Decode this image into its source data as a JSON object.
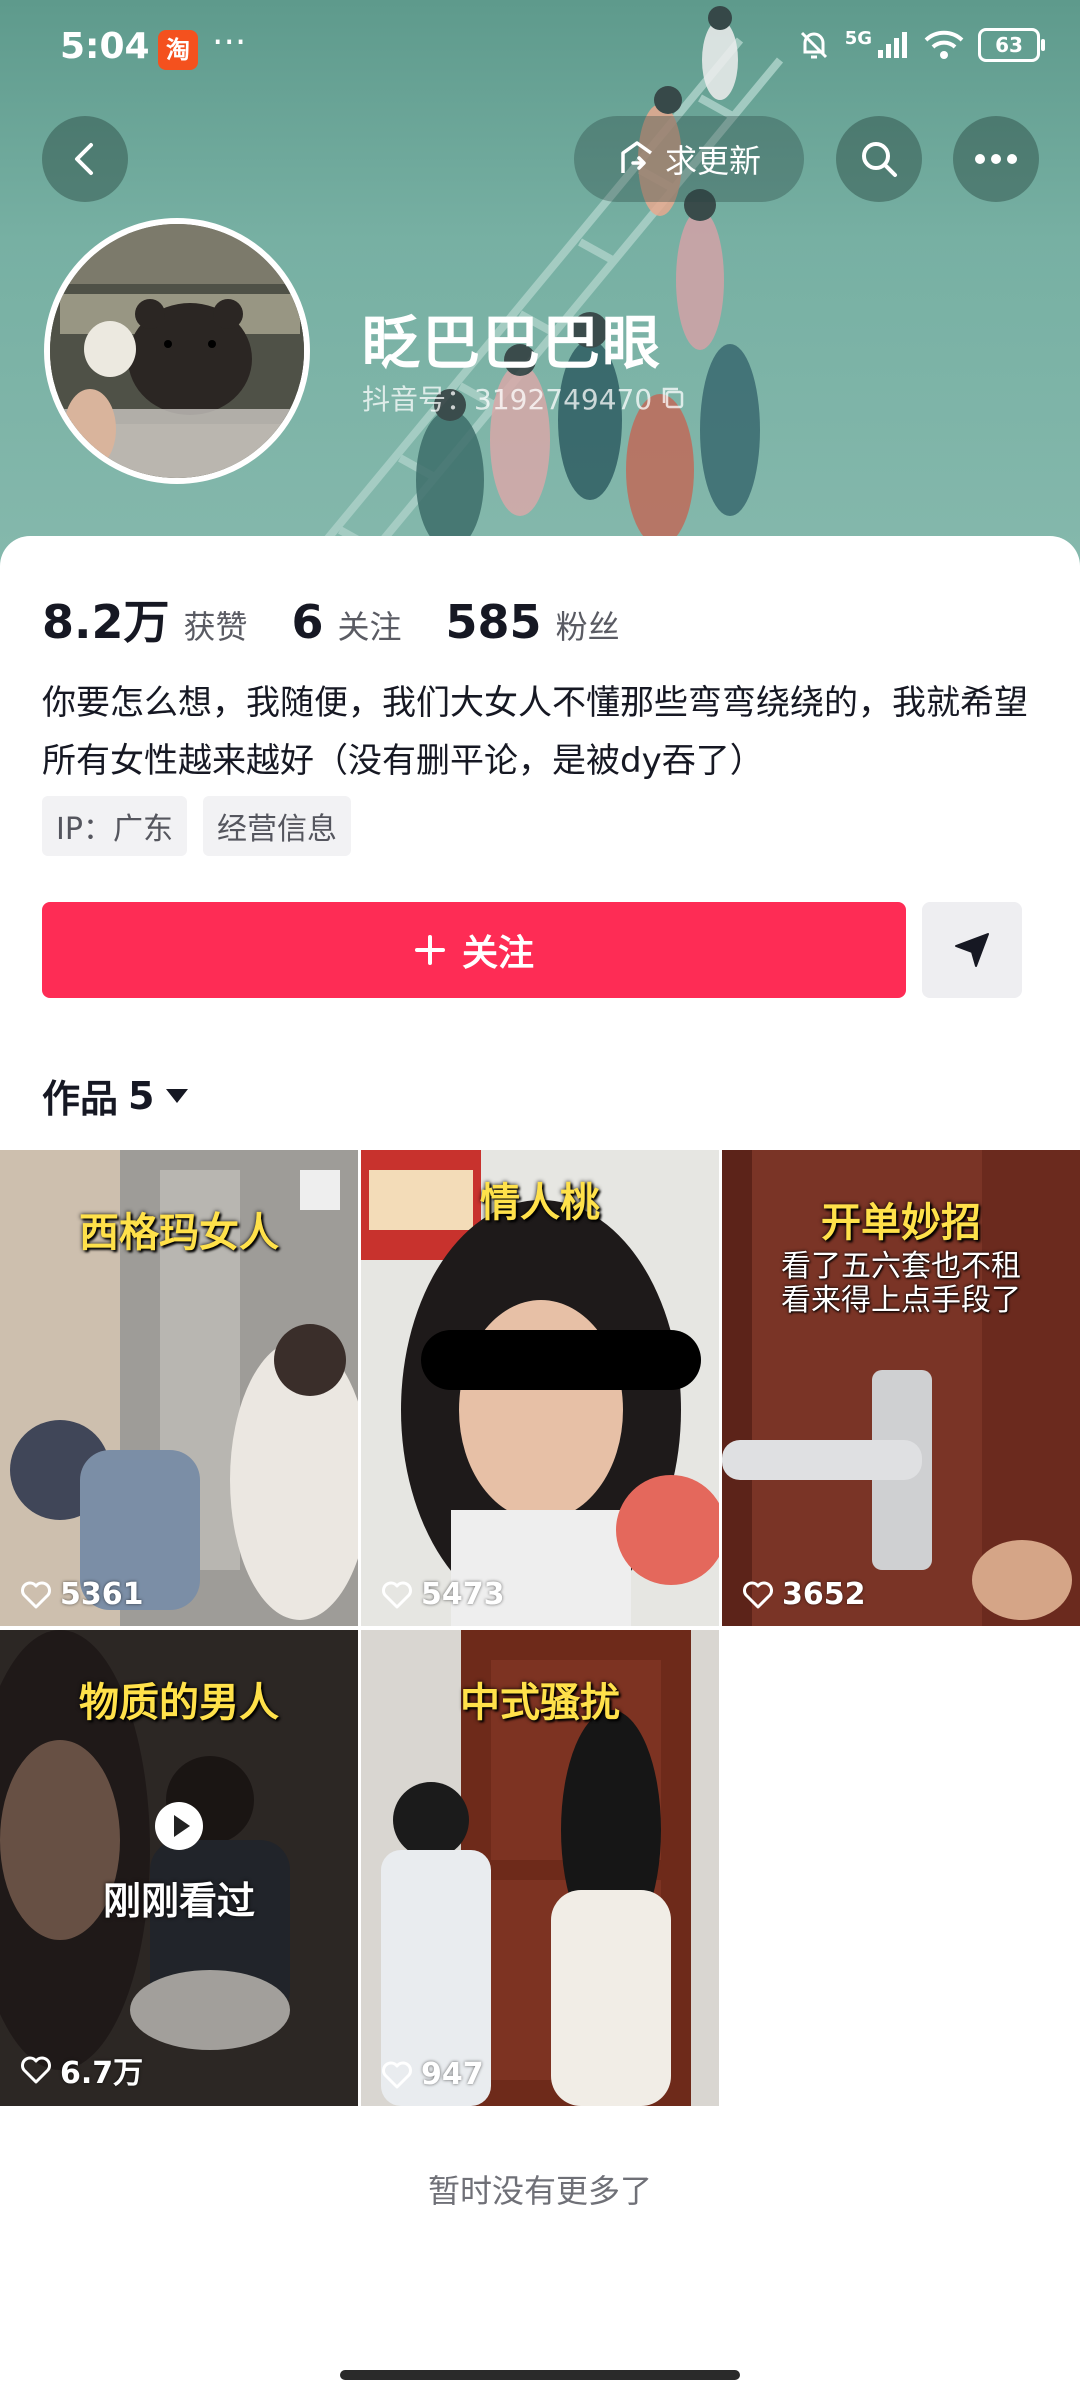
{
  "status_bar": {
    "time": "5:04",
    "app_badge": "淘",
    "more": "···",
    "signal": "5G",
    "battery": "63"
  },
  "header": {
    "update_label": "求更新"
  },
  "profile": {
    "name": "眨巴巴巴眼",
    "id_label": "抖音号：3192749470"
  },
  "stats": [
    {
      "value": "8.2万",
      "label": "获赞"
    },
    {
      "value": "6",
      "label": "关注"
    },
    {
      "value": "585",
      "label": "粉丝"
    }
  ],
  "bio": "你要怎么想，我随便，我们大女人不懂那些弯弯绕绕的，我就希望所有女性越来越好（没有删平论，是被dy吞了）",
  "tags": [
    "IP：广东",
    "经营信息"
  ],
  "follow_label": "关注",
  "works": {
    "title": "作品",
    "count": "5",
    "items": [
      {
        "title": "西格玛女人",
        "likes": "5361"
      },
      {
        "title": "情人桃",
        "likes": "5473"
      },
      {
        "title": "开单妙招",
        "subtitle": [
          "看了五六套也不租",
          "看来得上点手段了"
        ],
        "likes": "3652"
      },
      {
        "title": "物质的男人",
        "likes": "6.7万",
        "watched": "刚刚看过"
      },
      {
        "title": "中式骚扰",
        "likes": "947"
      }
    ]
  },
  "no_more": "暂时没有更多了"
}
